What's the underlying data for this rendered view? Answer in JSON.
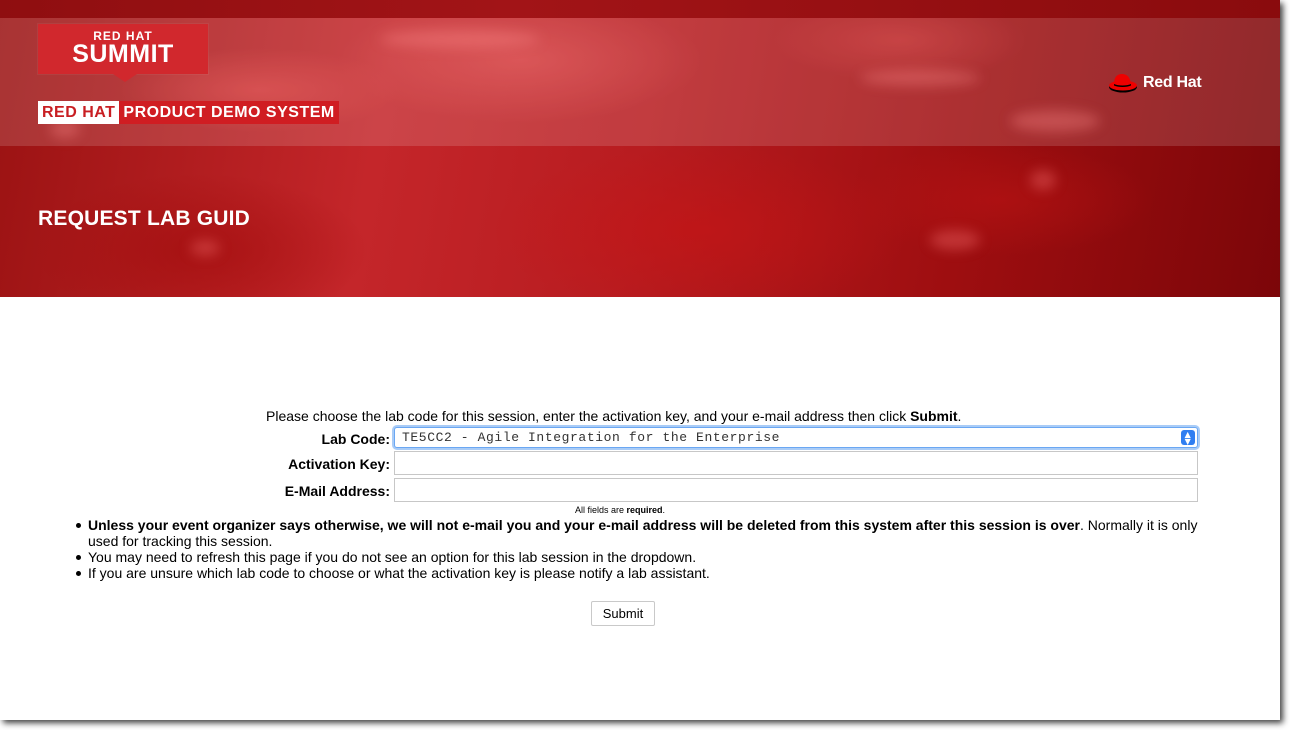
{
  "header": {
    "summit_line1": "RED HAT",
    "summit_line2": "SUMMIT",
    "demo_tag_a": "RED HAT",
    "demo_tag_b": "PRODUCT DEMO SYSTEM",
    "brand": "Red Hat",
    "page_title": "REQUEST LAB GUID"
  },
  "form": {
    "intro_prefix": "Please choose the lab code for this session, enter the activation key, and your e-mail address then click ",
    "intro_bold": "Submit",
    "intro_suffix": ".",
    "lab_code_label": "Lab Code:",
    "lab_code_value": "TE5CC2 - Agile Integration for the Enterprise",
    "activation_key_label": "Activation Key:",
    "activation_key_value": "",
    "email_label": "E-Mail Address:",
    "email_value": "",
    "required_prefix": "All fields are ",
    "required_bold": "required",
    "required_suffix": ".",
    "submit_label": "Submit"
  },
  "notes": {
    "n1_bold": "Unless your event organizer says otherwise, we will not e-mail you and your e-mail address will be deleted from this system after this session is over",
    "n1_rest": ". Normally it is only used for tracking this session.",
    "n2": "You may need to refresh this page if you do not see an option for this lab session in the dropdown.",
    "n3": "If you are unsure which lab code to choose or what the activation key is please notify a lab assistant."
  },
  "colors": {
    "brand_red": "#d1282d",
    "focus_blue": "#2f7ef1"
  },
  "icons": {
    "brand": "red-hat-fedora-icon",
    "select": "select-updown-arrows-icon",
    "bullet": "bullet-dot"
  }
}
